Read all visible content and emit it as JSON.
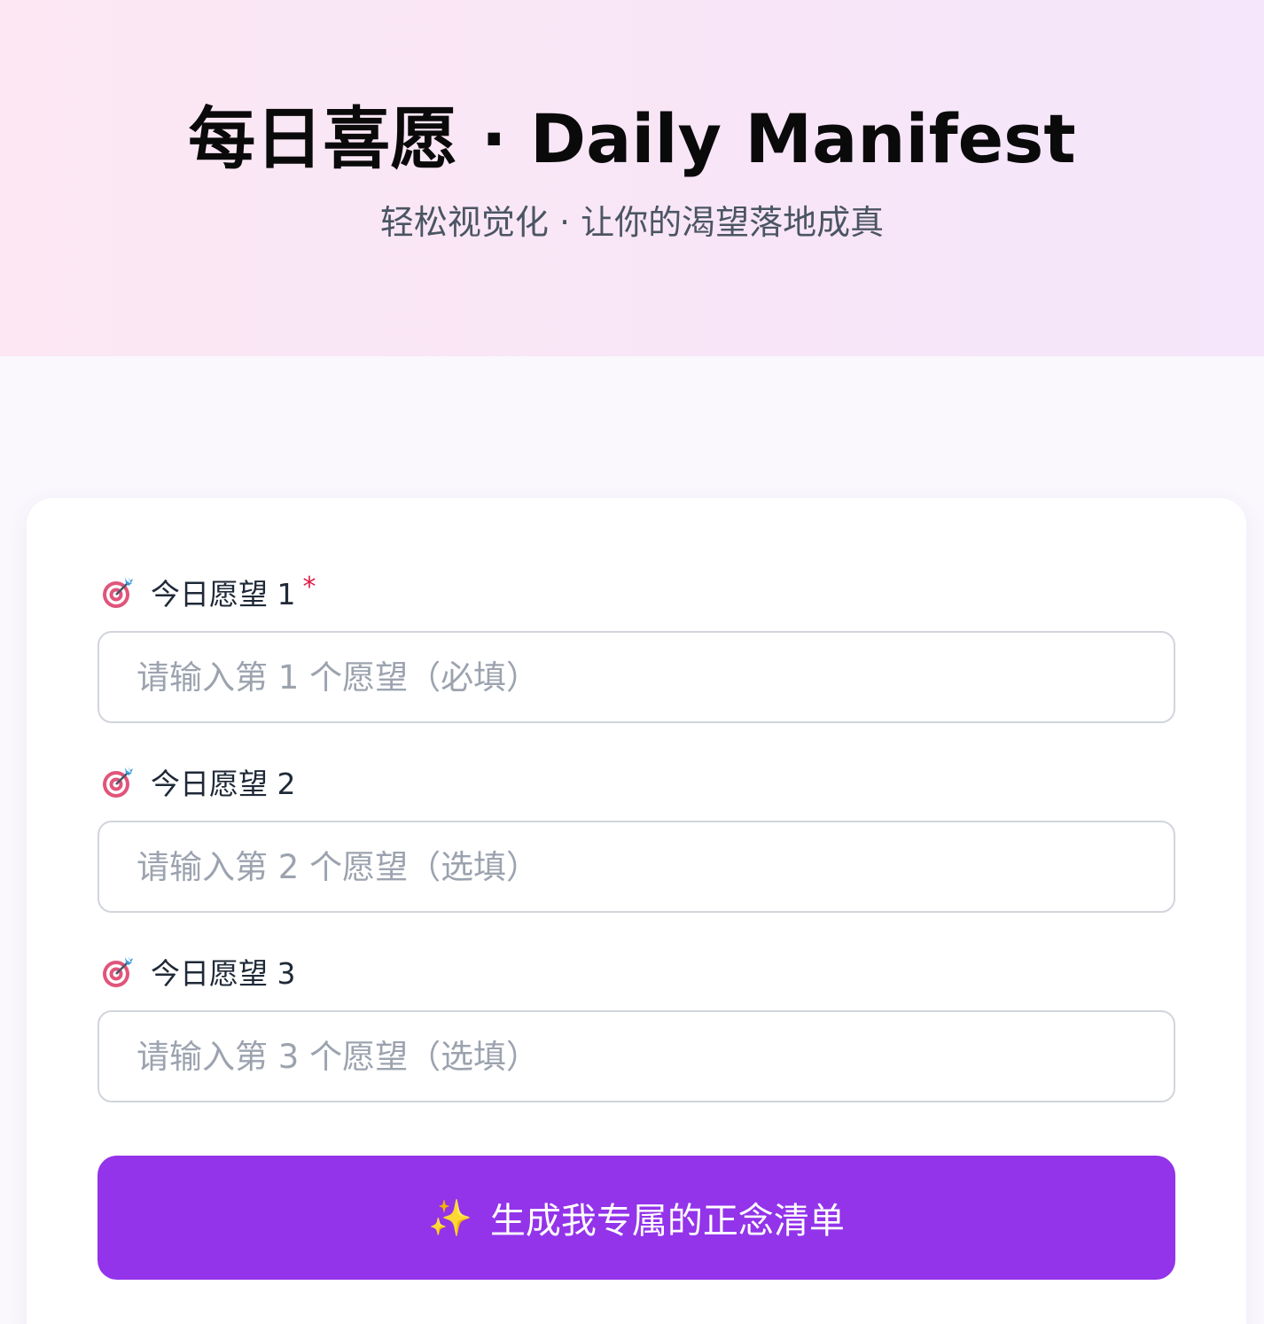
{
  "header": {
    "title": "每日喜愿 · Daily Manifest",
    "subtitle": "轻松视觉化 · 让你的渴望落地成真"
  },
  "form": {
    "fields": [
      {
        "label": "今日愿望 1",
        "required": true,
        "required_mark": "*",
        "placeholder": "请输入第 1 个愿望（必填）",
        "value": ""
      },
      {
        "label": "今日愿望 2",
        "required": false,
        "placeholder": "请输入第 2 个愿望（选填）",
        "value": ""
      },
      {
        "label": "今日愿望 3",
        "required": false,
        "placeholder": "请输入第 3 个愿望（选填）",
        "value": ""
      }
    ],
    "field_icon": "target-icon",
    "submit": {
      "icon": "sparkle-icon",
      "icon_glyph": "✨",
      "label": "生成我专属的正念清单"
    }
  },
  "colors": {
    "accent": "#9333ea",
    "required": "#e11d48",
    "header_gradient_start": "#fce7f3",
    "header_gradient_end": "#f5e6fb"
  }
}
